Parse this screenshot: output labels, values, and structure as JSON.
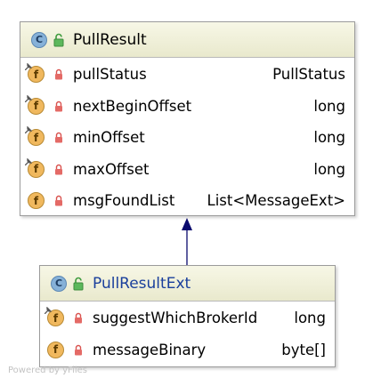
{
  "classes": [
    {
      "name": "PullResult",
      "icon_letter": "C",
      "name_color": "#000000",
      "fields": [
        {
          "name": "pullStatus",
          "type": "PullStatus",
          "pinned": true
        },
        {
          "name": "nextBeginOffset",
          "type": "long",
          "pinned": true
        },
        {
          "name": "minOffset",
          "type": "long",
          "pinned": true
        },
        {
          "name": "maxOffset",
          "type": "long",
          "pinned": true
        },
        {
          "name": "msgFoundList",
          "type": "List<MessageExt>",
          "pinned": false
        }
      ]
    },
    {
      "name": "PullResultExt",
      "icon_letter": "C",
      "name_color": "#1a3f9c",
      "fields": [
        {
          "name": "suggestWhichBrokerId",
          "type": "long",
          "pinned": true
        },
        {
          "name": "messageBinary",
          "type": "byte[]",
          "pinned": false
        }
      ]
    }
  ],
  "field_icon_letter": "f",
  "relation": {
    "type": "inheritance",
    "from": "PullResultExt",
    "to": "PullResult",
    "color": "#0a0a6e"
  },
  "footer": "Powered by yFiles"
}
